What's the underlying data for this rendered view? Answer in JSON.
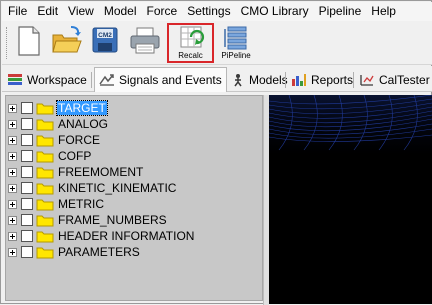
{
  "menu": [
    "File",
    "Edit",
    "View",
    "Model",
    "Force",
    "Settings",
    "CMO Library",
    "Pipeline",
    "Help"
  ],
  "toolbar": {
    "buttons": [
      {
        "name": "new-icon"
      },
      {
        "name": "open-folder-icon"
      },
      {
        "name": "save-cm2-icon",
        "badge": "CM2"
      },
      {
        "name": "print-icon"
      },
      {
        "name": "recalc-icon",
        "label": "Recalc"
      },
      {
        "name": "pipeline-icon",
        "label": "PiPeline"
      }
    ],
    "highlight_color": "#d9262a"
  },
  "tabs": [
    {
      "name": "tab-workspace",
      "label": "Workspace",
      "icon": "workspace-icon"
    },
    {
      "name": "tab-signals-and-events",
      "label": "Signals and Events",
      "icon": "signals-icon",
      "active": true
    },
    {
      "name": "tab-models",
      "label": "Models",
      "icon": "models-icon"
    },
    {
      "name": "tab-reports",
      "label": "Reports",
      "icon": "reports-icon"
    },
    {
      "name": "tab-caltester",
      "label": "CalTester",
      "icon": "caltester-icon"
    }
  ],
  "tree": {
    "items": [
      {
        "label": "TARGET",
        "selected": true
      },
      {
        "label": "ANALOG"
      },
      {
        "label": "FORCE"
      },
      {
        "label": "COFP"
      },
      {
        "label": "FREEMOMENT"
      },
      {
        "label": "KINETIC_KINEMATIC"
      },
      {
        "label": "METRIC"
      },
      {
        "label": "FRAME_NUMBERS"
      },
      {
        "label": "HEADER INFORMATION"
      },
      {
        "label": "PARAMETERS"
      }
    ],
    "selection_color": "#3399ff",
    "folder_color": "#ffe600"
  }
}
